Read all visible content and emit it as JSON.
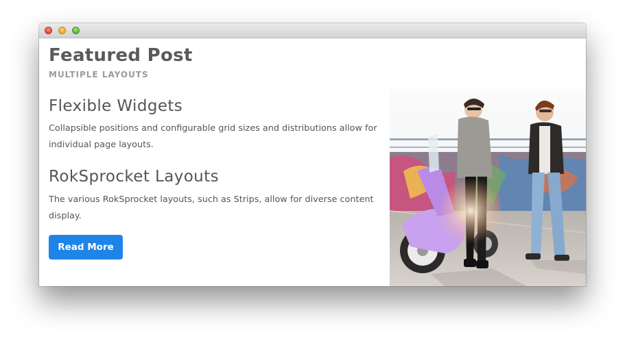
{
  "featured": {
    "title": "Featured Post",
    "subtitle": "MULTIPLE LAYOUTS"
  },
  "sections": [
    {
      "title": "Flexible Widgets",
      "text": "Collapsible positions and configurable grid sizes and distributions allow for individual page layouts."
    },
    {
      "title": "RokSprocket Layouts",
      "text": "The various RokSprocket layouts, such as Strips, allow for diverse content display."
    }
  ],
  "button": {
    "label": "Read More"
  },
  "colors": {
    "accent": "#1f84e8",
    "heading": "#5a5a5a",
    "subheading": "#9a9a9a",
    "body_text": "#555555"
  },
  "image": {
    "subject": "two people with a scooter in front of graffiti wall"
  }
}
